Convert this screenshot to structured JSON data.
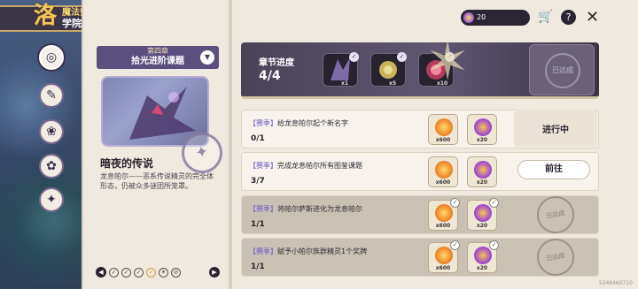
{
  "header": {
    "logo_char": "洛",
    "subtitle": "魔法师手册",
    "title": "学院作业"
  },
  "sidebar": {
    "items": [
      {
        "icon": "compass-icon",
        "glyph": "◎"
      },
      {
        "icon": "book-icon",
        "glyph": "✎"
      },
      {
        "icon": "paw-icon",
        "glyph": "❀"
      },
      {
        "icon": "chick-icon",
        "glyph": "✿"
      },
      {
        "icon": "badge-icon",
        "glyph": "✦"
      }
    ]
  },
  "chapter": {
    "number": "第四章",
    "title": "拾光进阶课题",
    "name": "暗夜的传说",
    "description": "龙息帕尔——恶系传说精灵的完全体形态，仍被众多谜团所笼罩。"
  },
  "pager": {
    "prev": "◀",
    "next": "▶",
    "dots": [
      "✓",
      "✓",
      "✓",
      "✓",
      "✶",
      "⊘"
    ]
  },
  "progress": {
    "label": "章节进度",
    "count": "4/4",
    "tiles": [
      {
        "amount": "x1"
      },
      {
        "amount": "x5"
      },
      {
        "amount": "x10"
      }
    ],
    "seal_text": "已达成"
  },
  "topbar": {
    "currency_amount": "20",
    "cart_icon": "🛒",
    "help_icon": "?",
    "close_icon": "✕"
  },
  "tasks": [
    {
      "season": "【赛季】",
      "name": "给龙息帕尔起个新名字",
      "progress": "0/1",
      "reward1": "x600",
      "reward2": "x20",
      "status": "进行中"
    },
    {
      "season": "【赛季】",
      "name": "完成龙息帕尔所有图鉴课题",
      "progress": "3/7",
      "reward1": "x600",
      "reward2": "x20",
      "action": "前往"
    },
    {
      "season": "【赛季】",
      "name": "将帕尔萨斯进化为龙息帕尔",
      "progress": "1/1",
      "reward1": "x600",
      "reward2": "x20",
      "stamp": "已达成"
    },
    {
      "season": "【赛季】",
      "name": "赋予小帕尔族群精灵1个奖牌",
      "progress": "1/1",
      "reward1": "x600",
      "reward2": "x20",
      "stamp": "已达成"
    }
  ],
  "watermark": "5348460710"
}
